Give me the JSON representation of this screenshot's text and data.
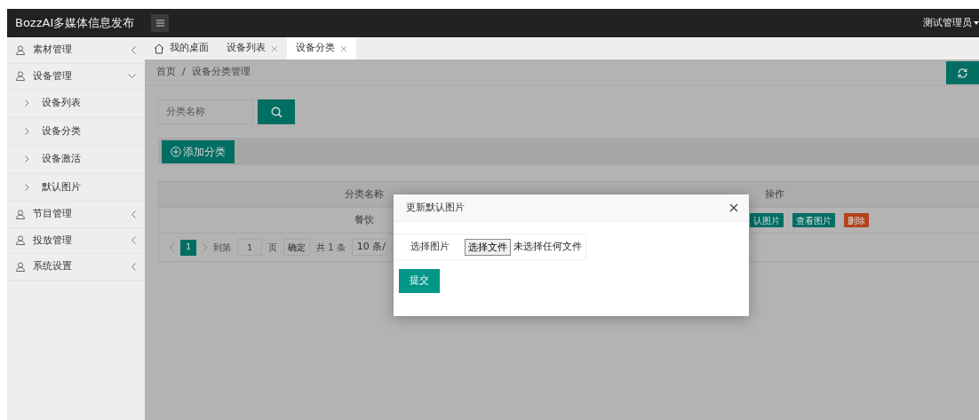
{
  "navbar": {
    "brand": "BozzAI多媒体信息发布",
    "user": "测试管理员"
  },
  "sidebar": {
    "items": [
      {
        "label": "素材管理",
        "expanded": false
      },
      {
        "label": "设备管理",
        "expanded": true,
        "children": [
          {
            "label": "设备列表"
          },
          {
            "label": "设备分类"
          },
          {
            "label": "设备激活"
          },
          {
            "label": "默认图片"
          }
        ]
      },
      {
        "label": "节目管理",
        "expanded": false
      },
      {
        "label": "投放管理",
        "expanded": false
      },
      {
        "label": "系统设置",
        "expanded": false
      }
    ]
  },
  "tabs": [
    {
      "label": "我的桌面",
      "kind": "home",
      "selected": false
    },
    {
      "label": "设备列表",
      "kind": "closable",
      "selected": false
    },
    {
      "label": "设备分类",
      "kind": "closable",
      "selected": true
    }
  ],
  "breadcrumb": {
    "items": [
      "首页",
      "设备分类管理"
    ],
    "separator": "/"
  },
  "search": {
    "placeholder": "分类名称"
  },
  "add_button": "添加分类",
  "table": {
    "columns": [
      "分类名称",
      "操作"
    ],
    "rows": [
      {
        "name": "餐饮",
        "actions": [
          {
            "label": "认图片",
            "kind": "primary"
          },
          {
            "label": "查看图片",
            "kind": "primary"
          },
          {
            "label": "删除",
            "kind": "danger"
          }
        ]
      }
    ]
  },
  "pagination": {
    "pages": [
      {
        "label": "1",
        "selected": true
      }
    ],
    "goto_label": "到第",
    "goto_value": "1",
    "page_unit": "页",
    "confirm": "确定",
    "total": "共 1 条",
    "page_size": "10 条/"
  },
  "modal": {
    "title": "更新默认图片",
    "field_label": "选择图片",
    "file_button": "选择文件",
    "file_status": "未选择任何文件",
    "submit": "提交"
  }
}
